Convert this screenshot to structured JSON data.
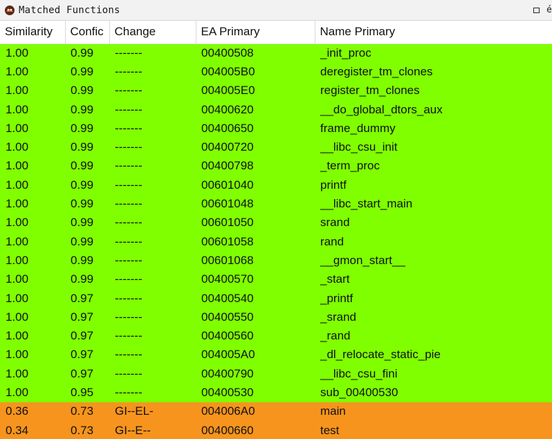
{
  "window": {
    "title": "Matched Functions",
    "float_glyph": "é"
  },
  "colors": {
    "matched_row": "#80ff00",
    "changed_row": "#f7941d"
  },
  "table": {
    "columns": [
      "Similarity",
      "Confic",
      "Change",
      "EA Primary",
      "Name Primary"
    ],
    "rows": [
      {
        "similarity": "1.00",
        "confidence": "0.99",
        "change": "-------",
        "ea": "00400508",
        "name": "_init_proc",
        "status": "matched"
      },
      {
        "similarity": "1.00",
        "confidence": "0.99",
        "change": "-------",
        "ea": "004005B0",
        "name": "deregister_tm_clones",
        "status": "matched"
      },
      {
        "similarity": "1.00",
        "confidence": "0.99",
        "change": "-------",
        "ea": "004005E0",
        "name": "register_tm_clones",
        "status": "matched"
      },
      {
        "similarity": "1.00",
        "confidence": "0.99",
        "change": "-------",
        "ea": "00400620",
        "name": "__do_global_dtors_aux",
        "status": "matched"
      },
      {
        "similarity": "1.00",
        "confidence": "0.99",
        "change": "-------",
        "ea": "00400650",
        "name": "frame_dummy",
        "status": "matched"
      },
      {
        "similarity": "1.00",
        "confidence": "0.99",
        "change": "-------",
        "ea": "00400720",
        "name": "__libc_csu_init",
        "status": "matched"
      },
      {
        "similarity": "1.00",
        "confidence": "0.99",
        "change": "-------",
        "ea": "00400798",
        "name": "_term_proc",
        "status": "matched"
      },
      {
        "similarity": "1.00",
        "confidence": "0.99",
        "change": "-------",
        "ea": "00601040",
        "name": "printf",
        "status": "matched"
      },
      {
        "similarity": "1.00",
        "confidence": "0.99",
        "change": "-------",
        "ea": "00601048",
        "name": "__libc_start_main",
        "status": "matched"
      },
      {
        "similarity": "1.00",
        "confidence": "0.99",
        "change": "-------",
        "ea": "00601050",
        "name": "srand",
        "status": "matched"
      },
      {
        "similarity": "1.00",
        "confidence": "0.99",
        "change": "-------",
        "ea": "00601058",
        "name": "rand",
        "status": "matched"
      },
      {
        "similarity": "1.00",
        "confidence": "0.99",
        "change": "-------",
        "ea": "00601068",
        "name": "__gmon_start__",
        "status": "matched"
      },
      {
        "similarity": "1.00",
        "confidence": "0.99",
        "change": "-------",
        "ea": "00400570",
        "name": "_start",
        "status": "matched"
      },
      {
        "similarity": "1.00",
        "confidence": "0.97",
        "change": "-------",
        "ea": "00400540",
        "name": "_printf",
        "status": "matched"
      },
      {
        "similarity": "1.00",
        "confidence": "0.97",
        "change": "-------",
        "ea": "00400550",
        "name": "_srand",
        "status": "matched"
      },
      {
        "similarity": "1.00",
        "confidence": "0.97",
        "change": "-------",
        "ea": "00400560",
        "name": "_rand",
        "status": "matched"
      },
      {
        "similarity": "1.00",
        "confidence": "0.97",
        "change": "-------",
        "ea": "004005A0",
        "name": "_dl_relocate_static_pie",
        "status": "matched"
      },
      {
        "similarity": "1.00",
        "confidence": "0.97",
        "change": "-------",
        "ea": "00400790",
        "name": "__libc_csu_fini",
        "status": "matched"
      },
      {
        "similarity": "1.00",
        "confidence": "0.95",
        "change": "-------",
        "ea": "00400530",
        "name": "sub_00400530",
        "status": "matched"
      },
      {
        "similarity": "0.36",
        "confidence": "0.73",
        "change": "GI--EL-",
        "ea": "004006A0",
        "name": "main",
        "status": "changed"
      },
      {
        "similarity": "0.34",
        "confidence": "0.73",
        "change": "GI--E--",
        "ea": "00400660",
        "name": "test",
        "status": "changed"
      }
    ]
  }
}
